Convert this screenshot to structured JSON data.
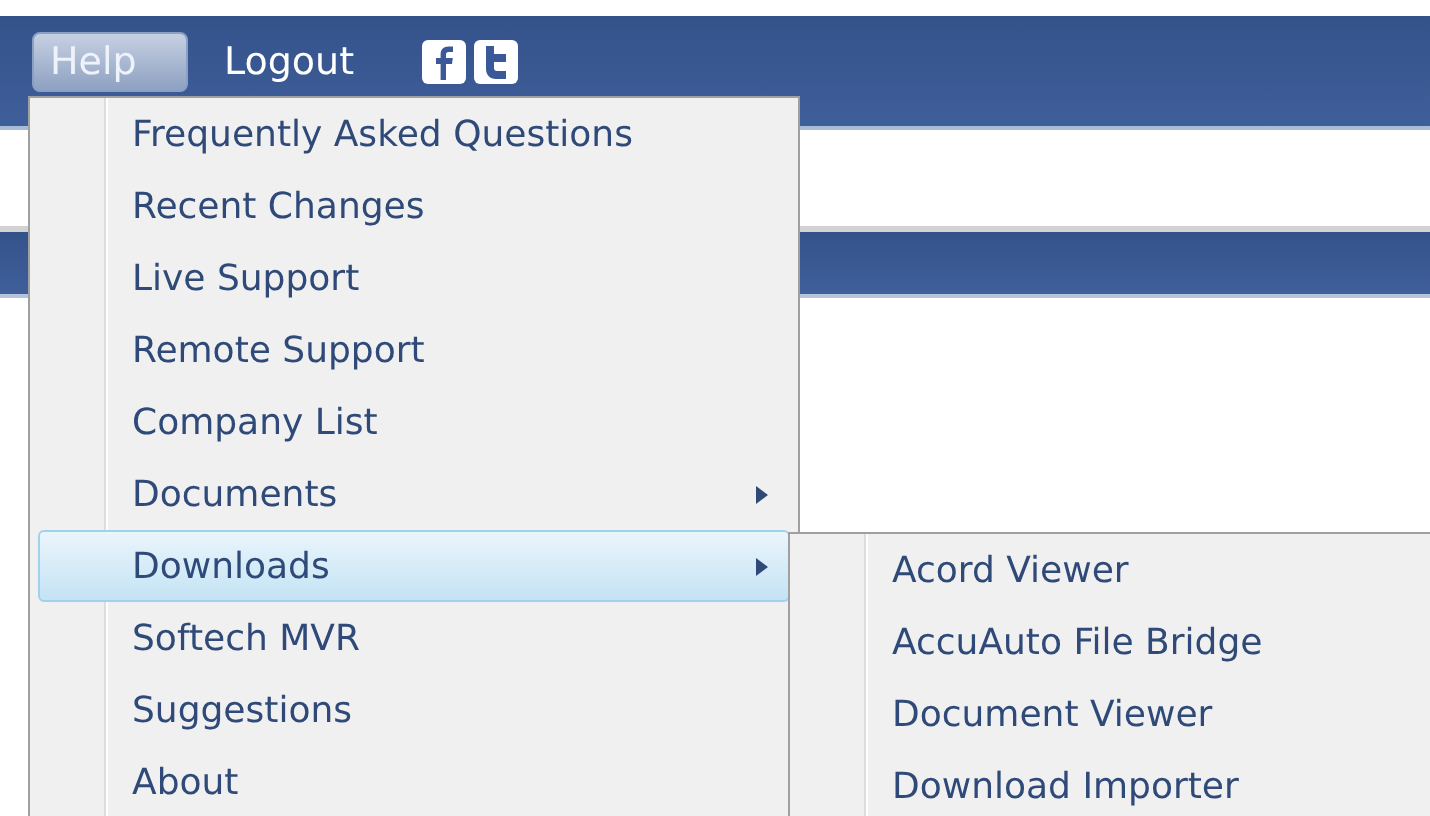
{
  "nav": [
    {
      "kind": "button",
      "label": "Help",
      "selected": true
    },
    {
      "kind": "link",
      "label": "Logout",
      "selected": false
    }
  ],
  "menu": [
    {
      "label": "Frequently Asked Questions",
      "submenu": false,
      "selected": false
    },
    {
      "label": "Recent Changes",
      "submenu": false,
      "selected": false
    },
    {
      "label": "Live Support",
      "submenu": false,
      "selected": false
    },
    {
      "label": "Remote Support",
      "submenu": false,
      "selected": false
    },
    {
      "label": "Company List",
      "submenu": false,
      "selected": false
    },
    {
      "label": "Documents",
      "submenu": true,
      "selected": false
    },
    {
      "label": "Downloads",
      "submenu": true,
      "selected": true
    },
    {
      "label": "Softech MVR",
      "submenu": false,
      "selected": false
    },
    {
      "label": "Suggestions",
      "submenu": false,
      "selected": false
    },
    {
      "label": "About",
      "submenu": false,
      "selected": false
    }
  ],
  "submenu": [
    {
      "label": "Acord Viewer"
    },
    {
      "label": "AccuAuto File Bridge"
    },
    {
      "label": "Document Viewer"
    },
    {
      "label": "Download Importer"
    }
  ]
}
